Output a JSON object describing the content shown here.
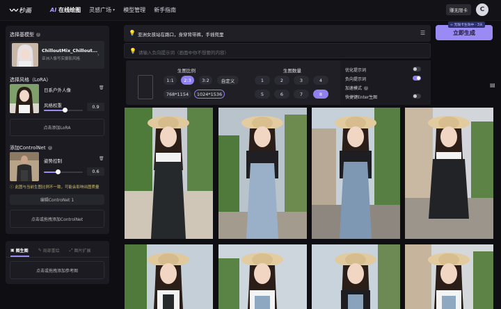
{
  "topbar": {
    "logo_mark": "〰",
    "logo_text": "秒画",
    "nav": [
      {
        "prefix": "AI",
        "label": "在线绘图",
        "active": true
      },
      {
        "label": "灵感广场",
        "has_chevron": true
      },
      {
        "label": "模型管理"
      },
      {
        "label": "新手指南"
      }
    ],
    "vip_label": "赚无限卡",
    "avatar_letter": "C"
  },
  "left_panel": {
    "base_model_title": "选择基模型",
    "base_model_name": "ChilloutMix_Chillout...",
    "base_model_sub": "亚洲人像写实摄影风格",
    "lora_title": "选择风格（LoRA）",
    "lora_name": "日系户外人像",
    "lora_weight_label": "风格权重",
    "lora_weight_value": "0.9",
    "lora_weight_fraction": 0.9,
    "add_lora": "点击添加LoRA",
    "controlnet_title": "添加ControlNet",
    "controlnet_name": "姿势控制",
    "controlnet_value": "0.6",
    "controlnet_fraction": 0.6,
    "warning": "此图与当前生图比例不一致，可能会影响出图质量",
    "edit_controlnet": "编辑ControNet 1",
    "add_controlnet": "点击或拖拽添加ControlNet"
  },
  "ref_panel": {
    "tabs": [
      "图生图",
      "局部重绘",
      "图片扩展"
    ],
    "upload_label": "点击或拖拽添加参考图"
  },
  "prompt": {
    "positive": "亚洲女孩站在路口，身穿背带裤，手插兜里",
    "negative_placeholder": "请输入负向提示词（画面中你不想要的内容）"
  },
  "generate": {
    "label": "立即生成",
    "tip": "∞ 无限卡生效中 · 3天"
  },
  "settings": {
    "ratio_title": "生图比例",
    "ratios": [
      "1:1",
      "2:3",
      "3:2",
      "自定义"
    ],
    "selected_ratio": "2:3",
    "sizes": [
      "768*1154",
      "1024*1536"
    ],
    "selected_size": "1024*1536",
    "count_title": "生图数量",
    "counts": [
      "1",
      "2",
      "3",
      "4",
      "5",
      "6",
      "7",
      "8"
    ],
    "selected_count": "8",
    "options": [
      {
        "label": "优化提示词",
        "on": false,
        "toggle": true
      },
      {
        "label": "负向提示词",
        "on": true,
        "toggle": true
      },
      {
        "label": "加速模式",
        "info": true,
        "toggle": false
      },
      {
        "label": "快捷键Enter生图",
        "on": false,
        "toggle": true
      }
    ]
  },
  "colors": {
    "accent": "#9a8af4",
    "background": "#0f0f13",
    "panel": "#1b1b21"
  }
}
